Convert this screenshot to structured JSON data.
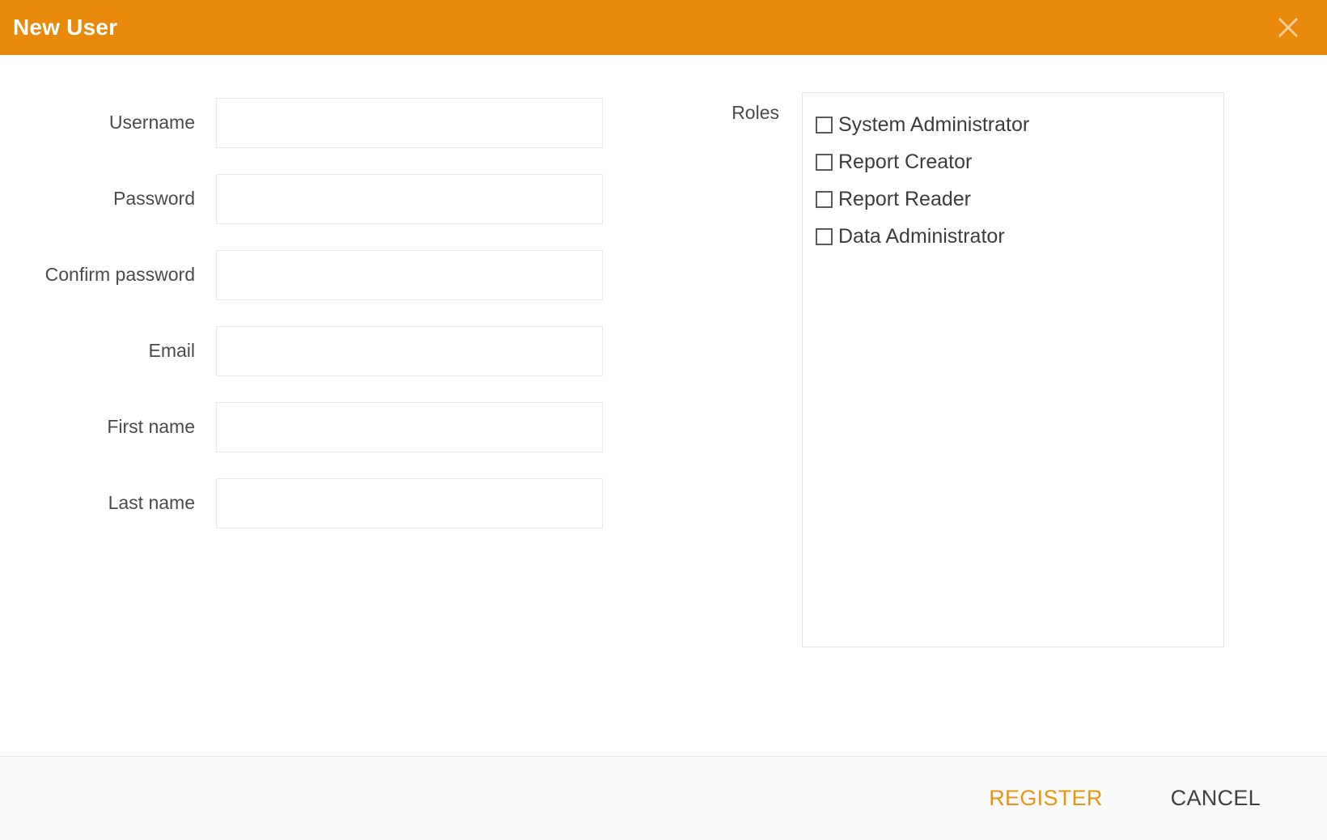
{
  "dialog": {
    "title": "New User",
    "close_icon": "close-icon",
    "header_color": "#e8890c"
  },
  "form": {
    "fields": [
      {
        "label": "Username",
        "value": "",
        "placeholder": "",
        "type": "text"
      },
      {
        "label": "Password",
        "value": "",
        "placeholder": "",
        "type": "password"
      },
      {
        "label": "Confirm password",
        "value": "",
        "placeholder": "",
        "type": "password"
      },
      {
        "label": "Email",
        "value": "",
        "placeholder": "",
        "type": "text"
      },
      {
        "label": "First name",
        "value": "",
        "placeholder": "",
        "type": "text"
      },
      {
        "label": "Last name",
        "value": "",
        "placeholder": "",
        "type": "text"
      }
    ]
  },
  "roles": {
    "label": "Roles",
    "items": [
      {
        "label": "System Administrator",
        "checked": false
      },
      {
        "label": "Report Creator",
        "checked": false
      },
      {
        "label": "Report Reader",
        "checked": false
      },
      {
        "label": "Data Administrator",
        "checked": false
      }
    ]
  },
  "footer": {
    "register_label": "REGISTER",
    "cancel_label": "CANCEL",
    "register_color": "#e8950f",
    "cancel_color": "#404040"
  },
  "background": {
    "clipped_text": " "
  }
}
